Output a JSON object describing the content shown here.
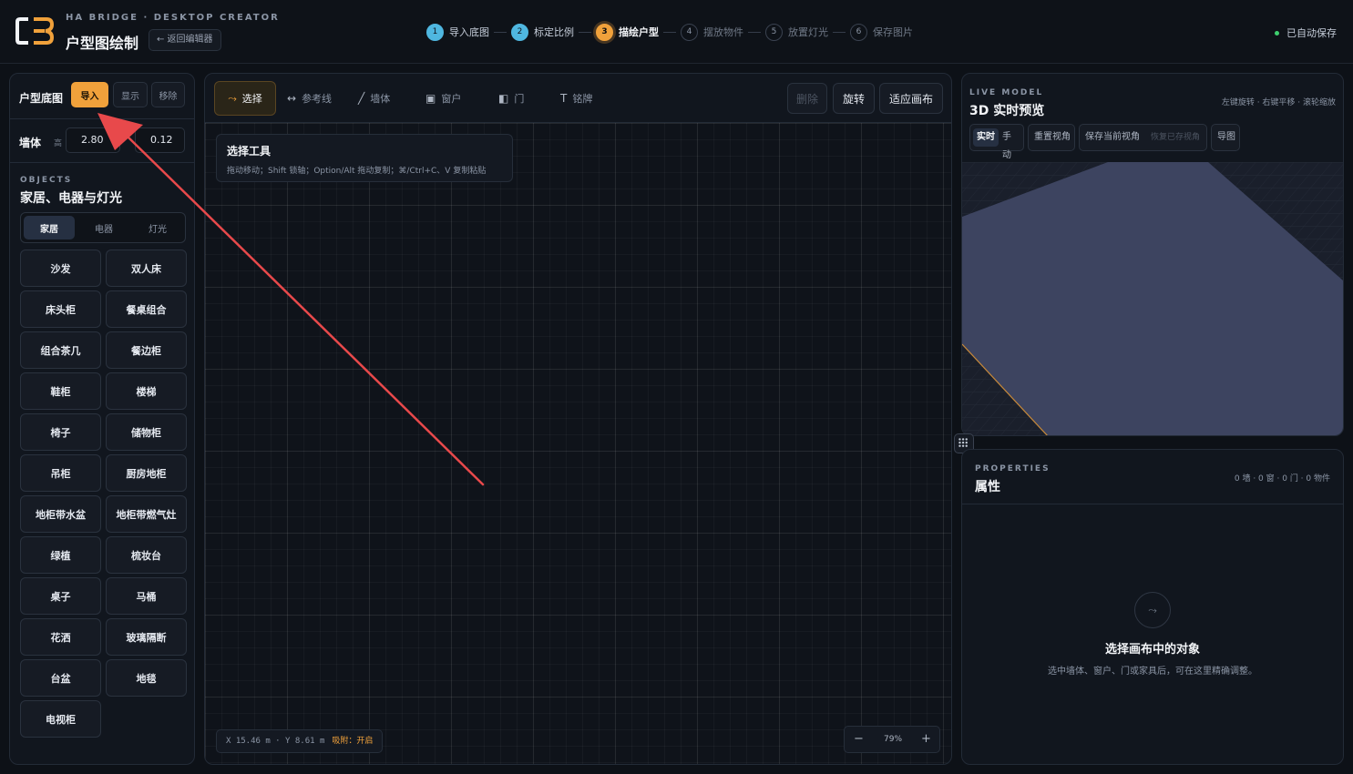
{
  "brand": {
    "logo_text": "C3",
    "subtitle": "HA BRIDGE · DESKTOP CREATOR",
    "title": "户型图绘制",
    "back_label": "← 返回编辑器"
  },
  "steps": [
    {
      "num": "1",
      "label": "导入底图",
      "state": "done"
    },
    {
      "num": "2",
      "label": "标定比例",
      "state": "done"
    },
    {
      "num": "3",
      "label": "描绘户型",
      "state": "active"
    },
    {
      "num": "4",
      "label": "摆放物件",
      "state": "pending"
    },
    {
      "num": "5",
      "label": "放置灯光",
      "state": "pending"
    },
    {
      "num": "6",
      "label": "保存图片",
      "state": "pending"
    }
  ],
  "autosave": "已自动保存",
  "left": {
    "floorplan_label": "户型底图",
    "import_label": "导入",
    "show_label": "显示",
    "remove_label": "移除",
    "wall_label": "墙体",
    "wall_height_label": "高",
    "wall_height": "2.80",
    "wall_thickness": "0.12",
    "objects_kicker": "OBJECTS",
    "objects_title": "家居、电器与灯光",
    "tabs": [
      "家居",
      "电器",
      "灯光"
    ],
    "items": [
      "沙发",
      "双人床",
      "床头柜",
      "餐桌组合",
      "组合茶几",
      "餐边柜",
      "鞋柜",
      "楼梯",
      "椅子",
      "储物柜",
      "吊柜",
      "厨房地柜",
      "地柜带水盆",
      "地柜带燃气灶",
      "绿植",
      "梳妆台",
      "桌子",
      "马桶",
      "花洒",
      "玻璃隔断",
      "台盆",
      "地毯",
      "电视柜"
    ]
  },
  "toolbar": {
    "select": "选择",
    "guide": "参考线",
    "wall": "墙体",
    "window": "窗户",
    "door": "门",
    "label": "铭牌",
    "delete": "删除",
    "rotate": "旋转",
    "fit": "适应画布"
  },
  "hint": {
    "title": "选择工具",
    "desc": "拖动移动；Shift 锁轴；Option/Alt 拖动复制；⌘/Ctrl+C、V 复制粘贴"
  },
  "status": {
    "coords": "X 15.46 m · Y 8.61 m",
    "snap": "吸附：开启",
    "zoom": "79%",
    "zoom_out": "−",
    "zoom_in": "+"
  },
  "preview": {
    "kicker": "LIVE MODEL",
    "title": "3D 实时预览",
    "help": "左键旋转 · 右键平移 · 滚轮缩放",
    "realtime": "实时",
    "manual": "手动",
    "reset_view": "重置视角",
    "save_view": "保存当前视角",
    "restore_view": "恢复已存视角",
    "export": "导图"
  },
  "properties": {
    "kicker": "PROPERTIES",
    "title": "属性",
    "stats": "0 墙 · 0 窗 · 0 门 · 0 物件",
    "empty_title": "选择画布中的对象",
    "empty_desc": "选中墙体、窗户、门或家具后，可在这里精确调整。"
  },
  "colors": {
    "accent": "#f0a13b",
    "done": "#4fb7e0",
    "arrow": "#e8494b",
    "autosave_dot": "#3ecf6e"
  }
}
